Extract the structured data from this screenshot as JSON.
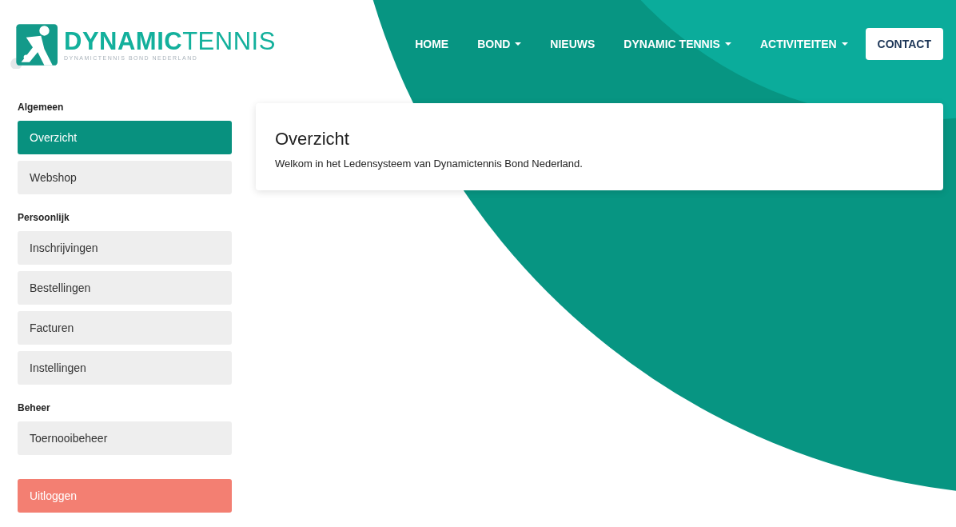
{
  "logo": {
    "title": "**DYNAMIC**TENNIS",
    "subtitle": "DYNAMICTENNIS BOND NEDERLAND"
  },
  "nav": [
    {
      "label": "HOME",
      "dropdown": false,
      "kind": "link"
    },
    {
      "label": "BOND",
      "dropdown": true,
      "kind": "link"
    },
    {
      "label": "NIEUWS",
      "dropdown": false,
      "kind": "link"
    },
    {
      "label": "DYNAMIC TENNIS",
      "dropdown": true,
      "kind": "link"
    },
    {
      "label": "ACTIVITEITEN",
      "dropdown": true,
      "kind": "link"
    },
    {
      "label": "CONTACT",
      "dropdown": false,
      "kind": "button"
    }
  ],
  "sidebar": {
    "groups": [
      {
        "heading": "Algemeen",
        "items": [
          {
            "label": "Overzicht",
            "selected": true
          },
          {
            "label": "Webshop",
            "selected": false
          }
        ]
      },
      {
        "heading": "Persoonlijk",
        "items": [
          {
            "label": "Inschrijvingen",
            "selected": false
          },
          {
            "label": "Bestellingen",
            "selected": false
          },
          {
            "label": "Facturen",
            "selected": false
          },
          {
            "label": "Instellingen",
            "selected": false
          }
        ]
      },
      {
        "heading": "Beheer",
        "items": [
          {
            "label": "Toernooibeheer",
            "selected": false
          }
        ]
      }
    ],
    "logout": {
      "label": "Uitloggen",
      "kind": "danger"
    }
  },
  "card": {
    "title": "Overzicht",
    "text": "Welkom in het Ledensysteem van Dynamictennis Bond Nederland."
  }
}
